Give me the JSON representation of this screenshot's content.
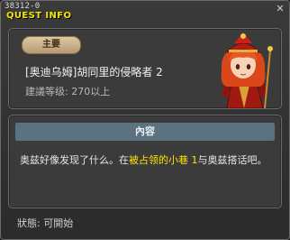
{
  "window": {
    "quest_id": "38312-0",
    "title": "QUEST INFO",
    "close_icon": "close-icon"
  },
  "quest": {
    "type_badge": "主要",
    "title": "[奥迪乌姆]胡同里的侵略者 2",
    "level_label": "建議等级:",
    "level_value": "270以上",
    "npc_portrait": "npc-portrait"
  },
  "content": {
    "header": "內容",
    "desc_part1": "奥兹好像发现了什么。在",
    "desc_highlight": "被占领的小巷 1",
    "desc_part2": "与奥兹搭话吧。"
  },
  "status": {
    "label": "狀態:",
    "value": "可開始"
  },
  "colors": {
    "title_yellow": "#f3e500",
    "highlight_yellow": "#ffe500",
    "header_bg": "#5b7280",
    "badge_bg": "#c9ae86"
  }
}
